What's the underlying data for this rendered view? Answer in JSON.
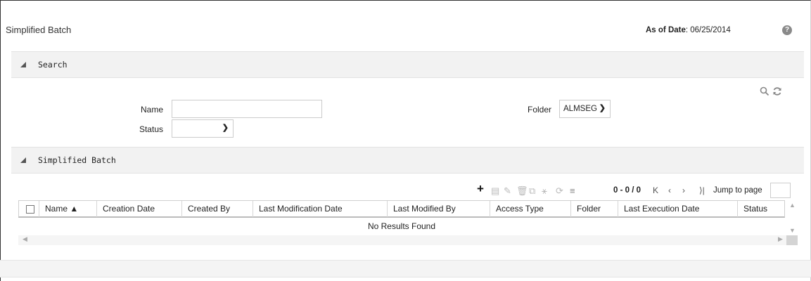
{
  "header": {
    "title": "Simplified Batch",
    "as_of_label": "As of Date",
    "as_of_value": ": 06/25/2014",
    "help_glyph": "?"
  },
  "search_section": {
    "label": "Search",
    "name_label": "Name",
    "name_value": "",
    "status_label": "Status",
    "status_value": "",
    "folder_label": "Folder",
    "folder_value": "ALMSEG"
  },
  "grid_section": {
    "label": "Simplified Batch",
    "pager_count": "0 - 0 / 0",
    "jump_label": "Jump to page",
    "jump_value": "",
    "columns": [
      "Name ▲",
      "Creation Date",
      "Created By",
      "Last Modification Date",
      "Last Modified By",
      "Access Type",
      "Folder",
      "Last Execution Date",
      "Status"
    ],
    "empty_message": "No Results Found"
  },
  "icons": {
    "search": "search-icon",
    "reset": "refresh-icon",
    "add": "add-icon",
    "view": "view-icon",
    "edit": "edit-icon",
    "delete": "delete-icon",
    "copy": "copy-icon",
    "run": "run-icon",
    "refresh": "refresh-list-icon",
    "filter": "filter-icon"
  }
}
